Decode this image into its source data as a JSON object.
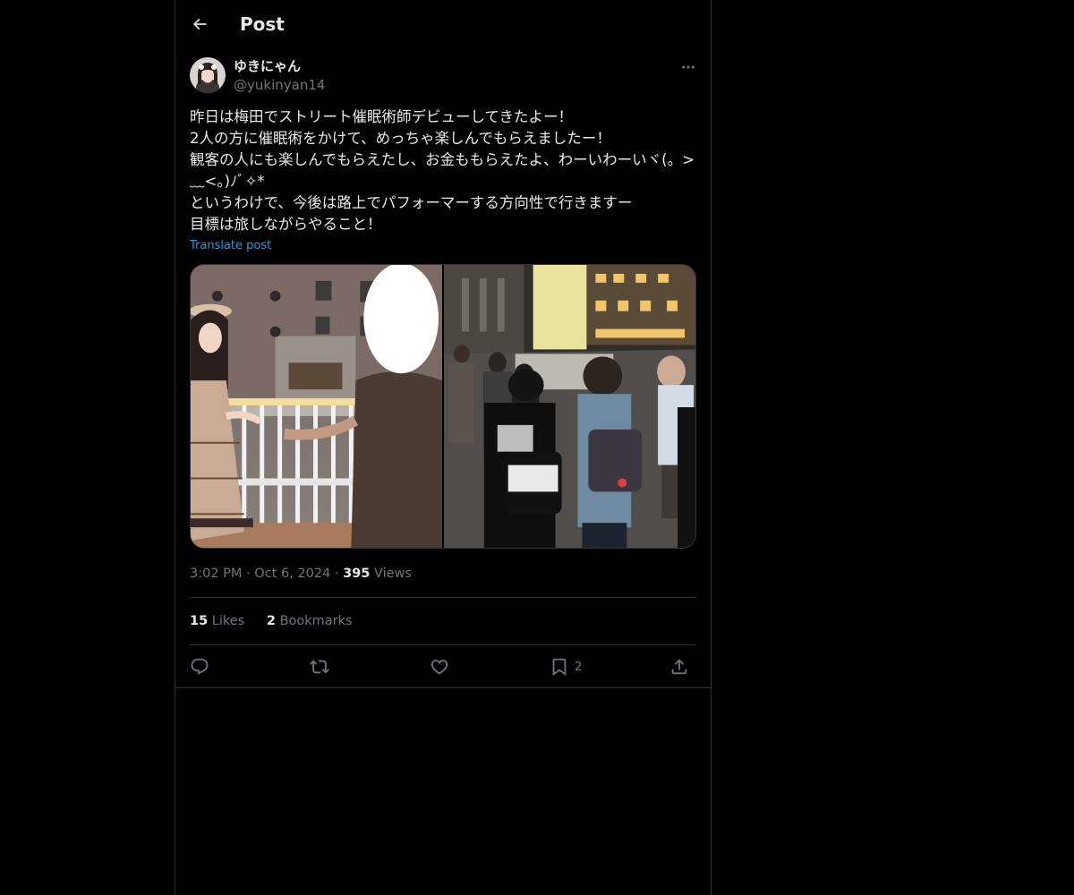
{
  "header": {
    "title": "Post",
    "back_icon": "arrow-left-icon"
  },
  "author": {
    "display_name": "ゆきにゃん",
    "handle": "@yukinyan14",
    "avatar": "avatar-photo",
    "more_icon": "more-horizontal-icon"
  },
  "post": {
    "text": "昨日は梅田でストリート催眠術師デビューしてきたよー！\n2人の方に催眠術をかけて、めっちゃ楽しんでもらえましたー！\n観客の人にも楽しんでもらえたし、お金ももらえたよ、わーいわーいヾ(。>﹏<。)ﾉﾞ✧*\nというわけで、今後は路上でパフォーマーする方向性で行きますー\n目標は旅しながらやること！",
    "translate_label": "Translate post",
    "media": [
      {
        "kind": "photo",
        "subject": "performer-in-dress-by-railing"
      },
      {
        "kind": "photo",
        "subject": "crowd-on-evening-walkway"
      }
    ]
  },
  "meta": {
    "time": "3:02 PM",
    "separator": "·",
    "date": "Oct 6, 2024",
    "views_count": "395",
    "views_label": "Views"
  },
  "stats": {
    "likes_count": "15",
    "likes_label": "Likes",
    "bookmarks_count": "2",
    "bookmarks_label": "Bookmarks"
  },
  "actions": {
    "reply_icon": "reply-icon",
    "repost_icon": "repost-icon",
    "like_icon": "heart-icon",
    "bookmark_icon": "bookmark-icon",
    "bookmark_count": "2",
    "share_icon": "share-icon"
  },
  "colors": {
    "background": "#000000",
    "text": "#e7e9ea",
    "muted": "#71767b",
    "link": "#1d9bf0",
    "border": "#2f3336"
  }
}
